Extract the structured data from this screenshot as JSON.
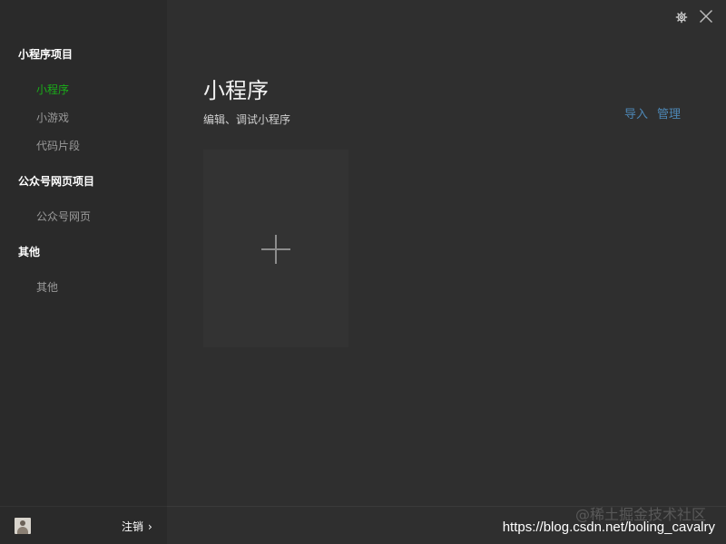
{
  "sidebar": {
    "sections": [
      {
        "title": "小程序项目",
        "items": [
          "小程序",
          "小游戏",
          "代码片段"
        ]
      },
      {
        "title": "公众号网页项目",
        "items": [
          "公众号网页"
        ]
      },
      {
        "title": "其他",
        "items": [
          "其他"
        ]
      }
    ],
    "active_item": "小程序",
    "footer": {
      "logout_label": "注销",
      "chevron": "›"
    }
  },
  "main": {
    "title": "小程序",
    "subtitle": "编辑、调试小程序",
    "actions": {
      "import_label": "导入",
      "manage_label": "管理"
    },
    "add_card": {
      "icon": "plus-icon"
    }
  },
  "window": {
    "settings_icon": "gear-icon",
    "close_icon": "close-icon"
  },
  "watermark": {
    "url": "https://blog.csdn.net/boling_cavalry",
    "cn": "@稀土掘金技术社区"
  },
  "colors": {
    "accent": "#1aad19",
    "link": "#4d87b5",
    "background": "#2f2f2f",
    "sidebar": "#2a2a2a"
  }
}
